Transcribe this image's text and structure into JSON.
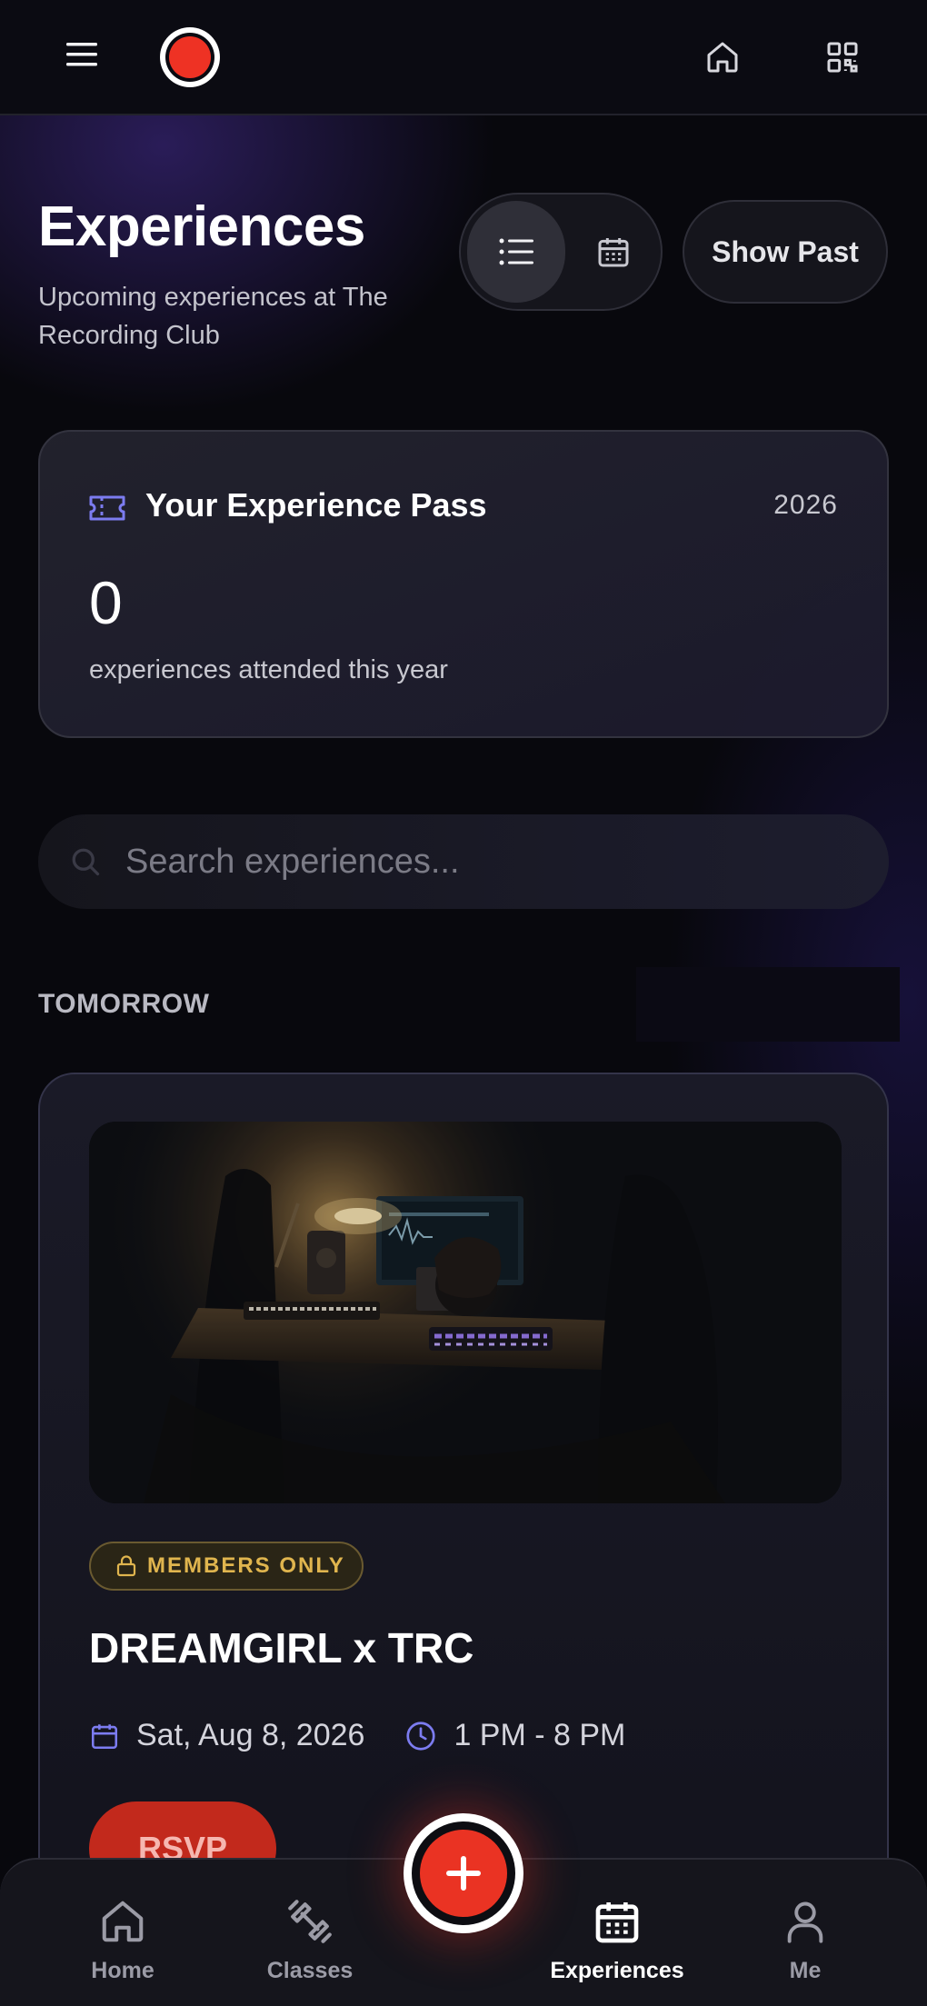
{
  "colors": {
    "accent": "#ee3224",
    "background": "#08080d",
    "card": "#1d1d29",
    "badge_gold": "#e0b54e",
    "icon_purple": "#7c7cf0"
  },
  "top_bar": {
    "icons": [
      "menu-icon",
      "logo",
      "home-icon",
      "qr-code-icon"
    ]
  },
  "header": {
    "title": "Experiences",
    "subtitle": "Upcoming experiences at The Recording Club",
    "view_modes": [
      "list-icon",
      "calendar-icon"
    ],
    "selected_view": "list",
    "show_past_label": "Show Past"
  },
  "pass": {
    "title": "Your Experience Pass",
    "year": "2026",
    "count": "0",
    "caption": "experiences attended this year"
  },
  "search": {
    "placeholder": "Search experiences...",
    "value": ""
  },
  "sections": [
    {
      "label": "TOMORROW",
      "events": [
        {
          "badge": "MEMBERS ONLY",
          "title": "DREAMGIRL x TRC",
          "date": "Sat, Aug 8, 2026",
          "time": "1 PM - 8 PM",
          "button": "RSVP"
        }
      ]
    }
  ],
  "bottom_nav": {
    "items": [
      {
        "label": "Home",
        "icon": "home-icon"
      },
      {
        "label": "Classes",
        "icon": "dumbbell-icon"
      },
      {
        "label": "Experiences",
        "icon": "calendar-icon",
        "active": true
      },
      {
        "label": "Me",
        "icon": "user-icon"
      }
    ],
    "fab_icon": "plus-icon"
  }
}
